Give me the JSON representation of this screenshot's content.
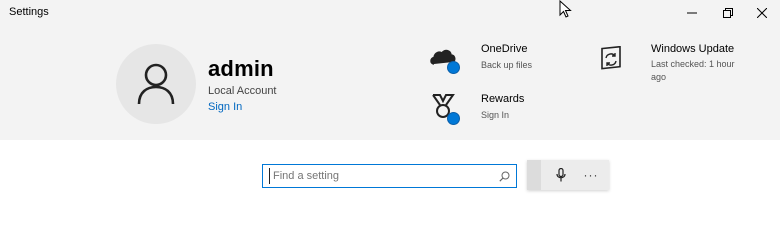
{
  "window": {
    "title": "Settings",
    "minimize_icon": "minimize-icon",
    "maximize_icon": "restore-icon",
    "close_icon": "close-icon"
  },
  "account": {
    "name": "admin",
    "type": "Local Account",
    "sign_in_label": "Sign In",
    "avatar_icon": "user-icon"
  },
  "tiles": {
    "onedrive": {
      "title": "OneDrive",
      "subtitle": "Back up files",
      "icon": "cloud-icon",
      "badge_color": "#0078d7"
    },
    "rewards": {
      "title": "Rewards",
      "subtitle": "Sign In",
      "icon": "medal-icon",
      "badge_color": "#0078d7"
    },
    "windows_update": {
      "title": "Windows Update",
      "subtitle_line1": "Last checked: 1 hour",
      "subtitle_line2": "ago",
      "icon": "sync-icon"
    }
  },
  "search": {
    "placeholder": "Find a setting",
    "value": "",
    "icon": "search-icon"
  },
  "voice": {
    "mic_icon": "microphone-icon",
    "more_label": "···"
  },
  "colors": {
    "accent": "#0078d7",
    "header_background": "#f3f3f3"
  }
}
